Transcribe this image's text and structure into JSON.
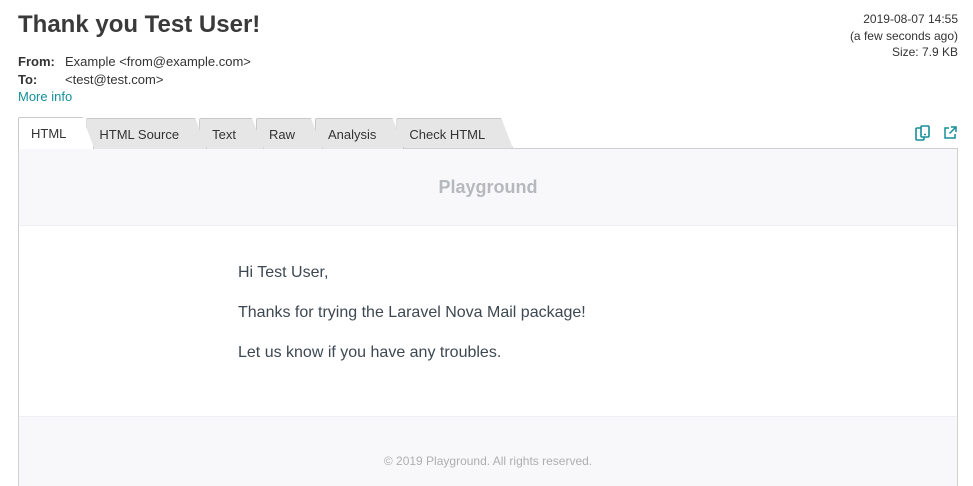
{
  "message": {
    "subject": "Thank you Test User!",
    "date": "2019-08-07 14:55",
    "relative_time": "(a few seconds ago)",
    "size": "Size: 7.9 KB"
  },
  "headers": {
    "from_label": "From:",
    "from_value": "Example <from@example.com>",
    "to_label": "To:",
    "to_value": "<test@test.com>",
    "more_info": "More info"
  },
  "tabs": [
    {
      "label": "HTML",
      "active": true
    },
    {
      "label": "HTML Source",
      "active": false
    },
    {
      "label": "Text",
      "active": false
    },
    {
      "label": "Raw",
      "active": false
    },
    {
      "label": "Analysis",
      "active": false
    },
    {
      "label": "Check HTML",
      "active": false
    }
  ],
  "toolbar": {
    "icons": [
      "responsive-view-icon",
      "open-external-icon"
    ],
    "accent_color": "#148f99"
  },
  "email": {
    "brand": "Playground",
    "greeting": "Hi Test User,",
    "line1": "Thanks for trying the Laravel Nova Mail package!",
    "line2": "Let us know if you have any troubles.",
    "footer": "© 2019 Playground. All rights reserved."
  }
}
